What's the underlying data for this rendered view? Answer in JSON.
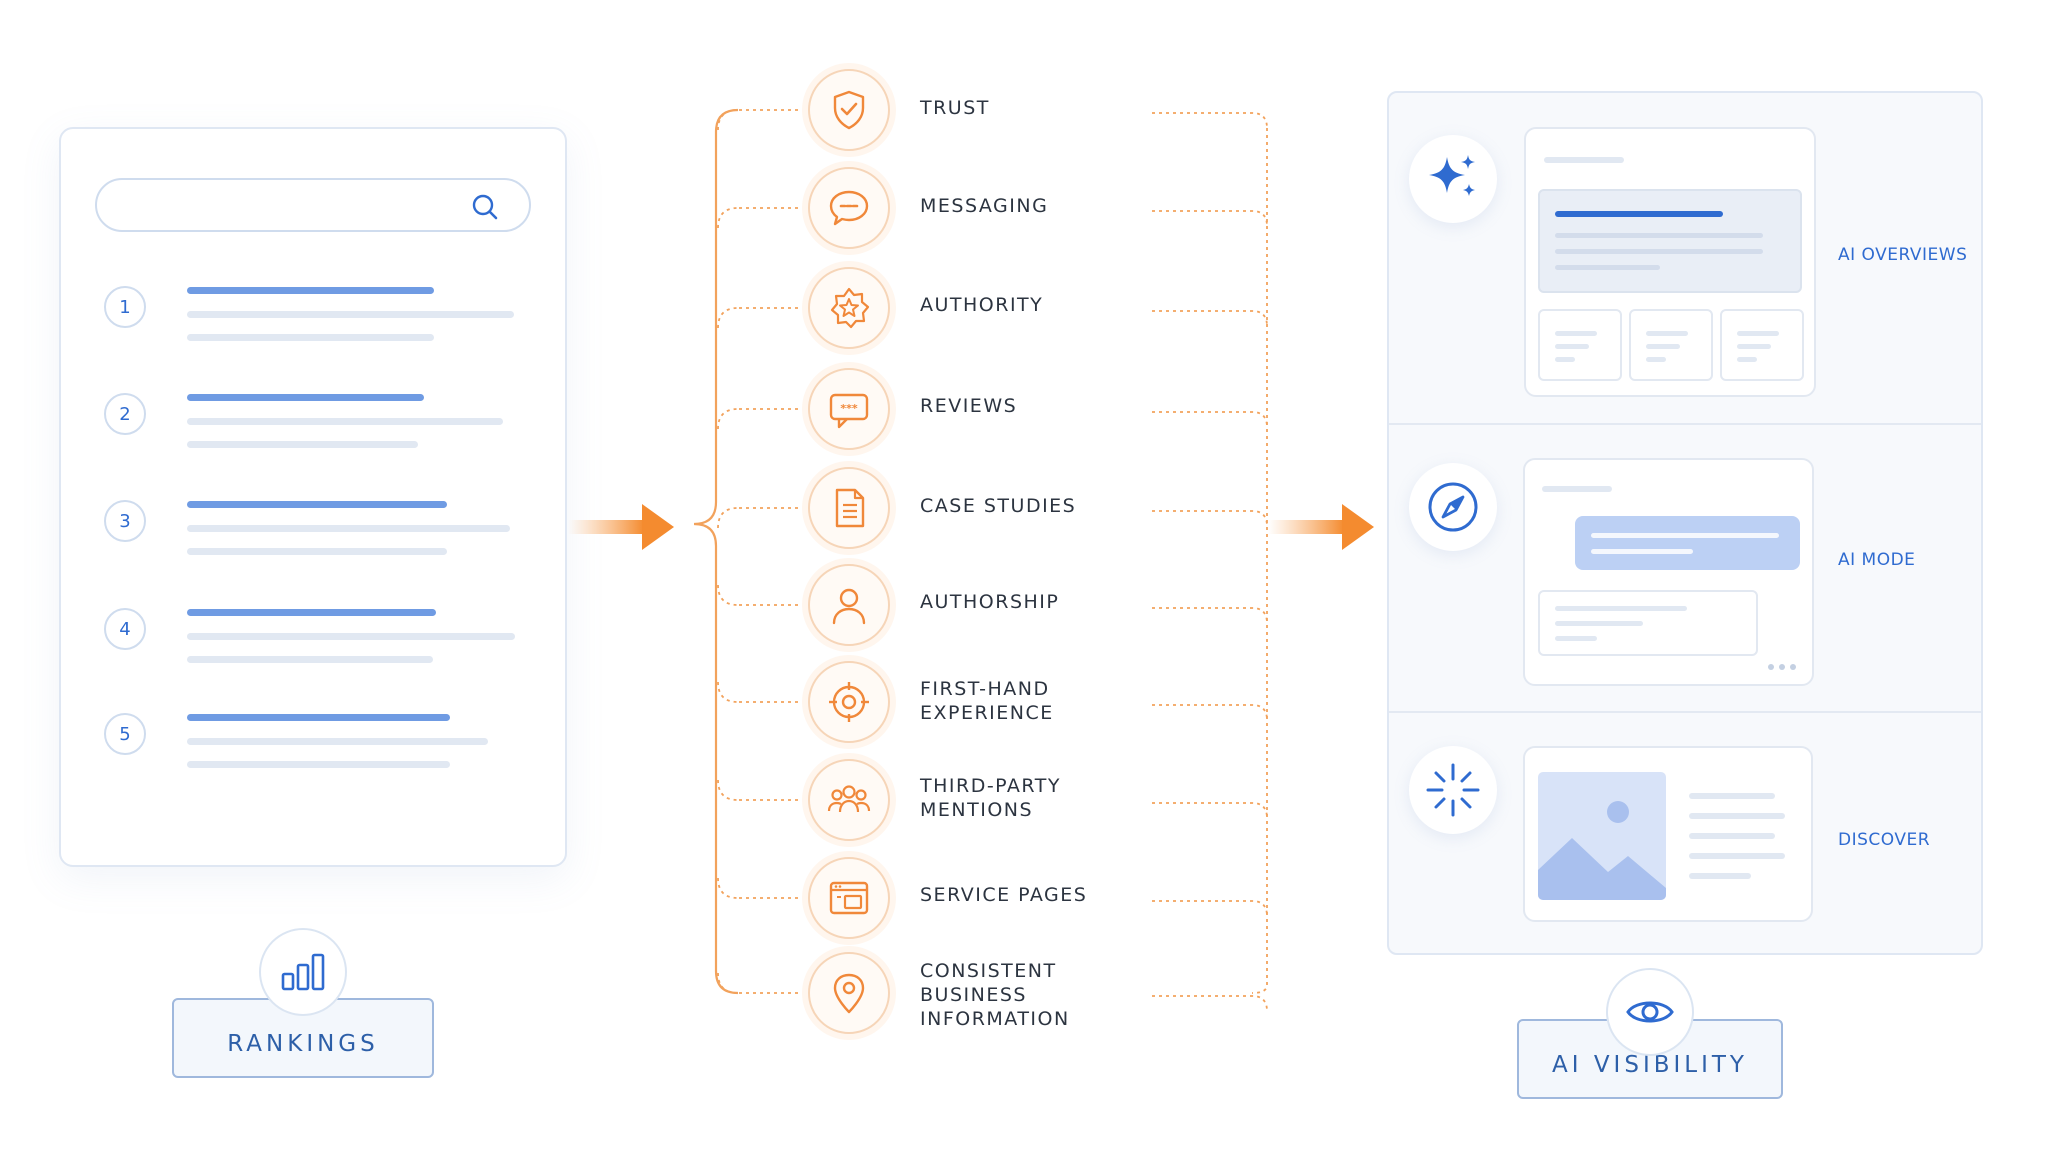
{
  "rankings": {
    "label": "RANKINGS",
    "positions": [
      "1",
      "2",
      "3",
      "4",
      "5"
    ]
  },
  "factors": [
    {
      "label": "TRUST",
      "icon": "shield-check-icon"
    },
    {
      "label": "MESSAGING",
      "icon": "chat-bubble-icon"
    },
    {
      "label": "AUTHORITY",
      "icon": "star-badge-icon"
    },
    {
      "label": "REVIEWS",
      "icon": "review-bubble-icon"
    },
    {
      "label": "CASE STUDIES",
      "icon": "document-icon"
    },
    {
      "label": "AUTHORSHIP",
      "icon": "person-icon"
    },
    {
      "label": "FIRST-HAND\nEXPERIENCE",
      "icon": "target-icon"
    },
    {
      "label": "THIRD-PARTY\nMENTIONS",
      "icon": "group-icon"
    },
    {
      "label": "SERVICE PAGES",
      "icon": "browser-window-icon"
    },
    {
      "label": "CONSISTENT\nBUSINESS\nINFORMATION",
      "icon": "map-pin-icon"
    }
  ],
  "visibility": {
    "label": "AI VISIBILITY",
    "sections": [
      {
        "label": "AI OVERVIEWS",
        "icon": "sparkle-icon"
      },
      {
        "label": "AI MODE",
        "icon": "compass-icon"
      },
      {
        "label": "DISCOVER",
        "icon": "burst-icon"
      }
    ]
  },
  "colors": {
    "primary_blue": "#2f6bd0",
    "accent_orange": "#f0883a",
    "line_orange": "#f2a25c"
  }
}
